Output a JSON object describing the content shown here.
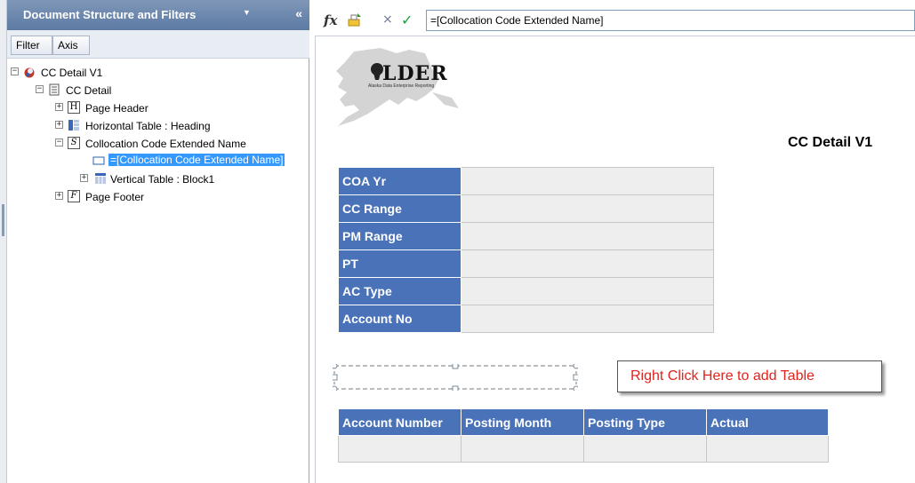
{
  "panel": {
    "title": "Document Structure and Filters",
    "caret": "▼",
    "collapse": "«",
    "tabs": [
      "Filter",
      "Axis"
    ]
  },
  "tree": [
    {
      "label": "CC Detail V1",
      "expander": "−",
      "icon": "report-icon"
    },
    {
      "label": "CC Detail",
      "expander": "−",
      "icon": "page-icon"
    },
    {
      "label": "Page Header",
      "expander": "+",
      "icon": "header-icon",
      "icon_text": "H"
    },
    {
      "label": "Horizontal Table : Heading",
      "expander": "+",
      "icon": "horizontal-table-icon"
    },
    {
      "label": "Collocation Code Extended Name",
      "expander": "−",
      "icon": "section-icon",
      "icon_text": "S"
    },
    {
      "label": "=[Collocation Code Extended Name]",
      "icon": "cell-icon",
      "selected": true
    },
    {
      "label": "Vertical Table : Block1",
      "expander": "+",
      "icon": "vertical-table-icon"
    },
    {
      "label": "Page Footer",
      "expander": "+",
      "icon": "footer-icon",
      "icon_text": "F"
    }
  ],
  "formula": {
    "fx_label": "fx",
    "cancel": "×",
    "accept": "✓",
    "value": "=[Collocation Code Extended Name]"
  },
  "report": {
    "logo_text": "LDER",
    "logo_subtext": "Alaska Data Enterprise Reporting",
    "title": "CC Detail V1",
    "vertical_rows": [
      "COA Yr",
      "CC Range",
      "PM Range",
      "PT",
      "AC Type",
      "Account No"
    ],
    "columns": [
      "Account Number",
      "Posting Month",
      "Posting Type",
      "Actual"
    ],
    "hint": "Right Click Here to add Table"
  },
  "colors": {
    "header_blue": "#4a72b9",
    "cell_gray": "#eeeeee",
    "hint_red": "#e0241c",
    "selection": "#3399ff"
  }
}
